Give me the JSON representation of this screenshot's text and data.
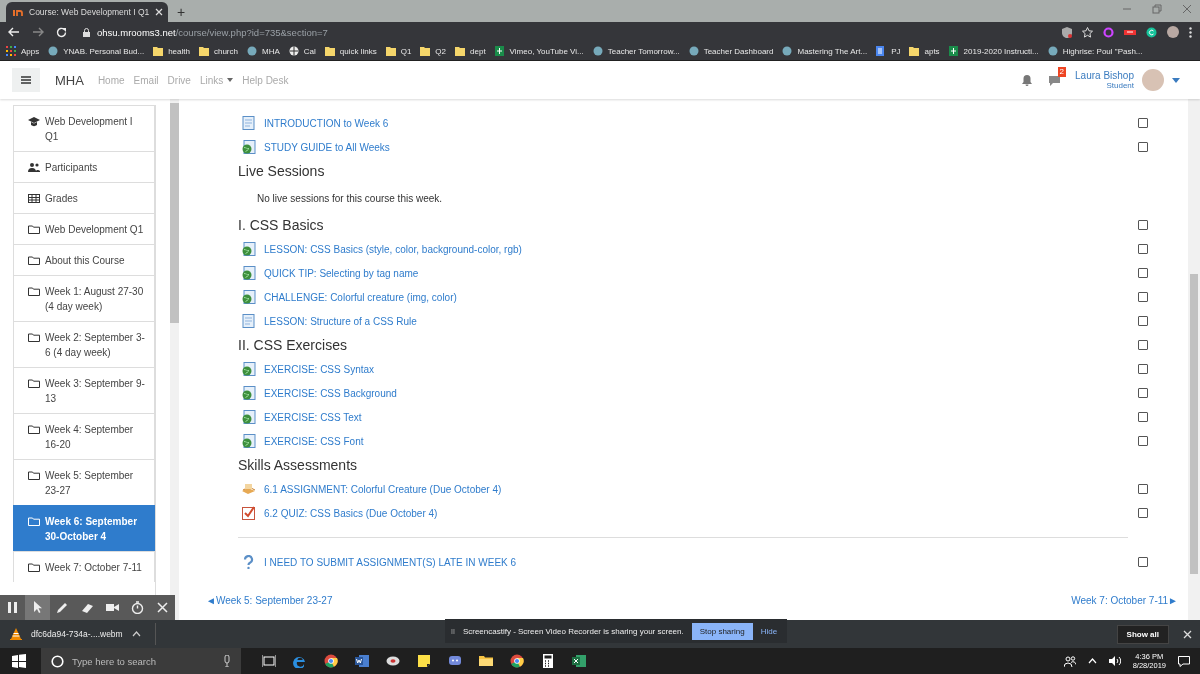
{
  "browser": {
    "tab_title": "Course: Web Development I Q1",
    "new_tab": "+",
    "url_host": "ohsu.mrooms3.net",
    "url_path": "/course/view.php?id=735&section=7",
    "bookmarks": [
      {
        "kind": "apps",
        "label": "Apps"
      },
      {
        "kind": "site",
        "label": "YNAB. Personal Bud..."
      },
      {
        "kind": "folder",
        "label": "health"
      },
      {
        "kind": "folder",
        "label": "church"
      },
      {
        "kind": "site",
        "label": "MHA"
      },
      {
        "kind": "globe",
        "label": "Cal"
      },
      {
        "kind": "folder",
        "label": "quick links"
      },
      {
        "kind": "folder",
        "label": "Q1"
      },
      {
        "kind": "folder",
        "label": "Q2"
      },
      {
        "kind": "folder",
        "label": "dept"
      },
      {
        "kind": "sheet",
        "label": "Vimeo, YouTube Vi..."
      },
      {
        "kind": "site",
        "label": "Teacher Tomorrow..."
      },
      {
        "kind": "site",
        "label": "Teacher Dashboard"
      },
      {
        "kind": "site",
        "label": "Mastering The Art..."
      },
      {
        "kind": "doc",
        "label": "PJ"
      },
      {
        "kind": "folder",
        "label": "apts"
      },
      {
        "kind": "sheet",
        "label": "2019-2020 Instructi..."
      },
      {
        "kind": "site",
        "label": "Highrise: Poul \"Pash..."
      }
    ]
  },
  "navbar": {
    "brand": "MHA",
    "links": [
      {
        "label": "Home",
        "dropdown": false
      },
      {
        "label": "Email",
        "dropdown": false
      },
      {
        "label": "Drive",
        "dropdown": false
      },
      {
        "label": "Links",
        "dropdown": true
      },
      {
        "label": "Help Desk",
        "dropdown": false
      }
    ],
    "message_count": "2",
    "user_name": "Laura Bishop",
    "user_role": "Student"
  },
  "sidebar": {
    "items": [
      {
        "kind": "course",
        "label": "Web Development I Q1",
        "selected": false
      },
      {
        "kind": "participants",
        "label": "Participants",
        "selected": false
      },
      {
        "kind": "grades",
        "label": "Grades",
        "selected": false
      },
      {
        "kind": "section",
        "label": "Web Development Q1",
        "selected": false
      },
      {
        "kind": "section",
        "label": "About this Course",
        "selected": false
      },
      {
        "kind": "section",
        "label": "Week 1: August 27-30 (4 day week)",
        "selected": false
      },
      {
        "kind": "section",
        "label": "Week 2: September 3-6 (4 day week)",
        "selected": false
      },
      {
        "kind": "section",
        "label": "Week 3: September 9-13",
        "selected": false
      },
      {
        "kind": "section",
        "label": "Week 4: September 16-20",
        "selected": false
      },
      {
        "kind": "section",
        "label": "Week 5: September 23-27",
        "selected": false
      },
      {
        "kind": "section",
        "label": "Week 6: September 30-October 4",
        "selected": true
      },
      {
        "kind": "section",
        "label": "Week 7: October 7-11",
        "selected": false
      }
    ]
  },
  "content": {
    "rows": [
      {
        "kind": "page",
        "label": "INTRODUCTION to Week 6",
        "checked": false
      },
      {
        "kind": "url",
        "label": "STUDY GUIDE to All Weeks",
        "checked": false
      },
      {
        "kind": "heading",
        "label": "Live Sessions"
      },
      {
        "kind": "note",
        "label": "No live sessions for this course this week."
      },
      {
        "kind": "heading",
        "label": "I. CSS Basics",
        "checked": false
      },
      {
        "kind": "url",
        "label": "LESSON: CSS Basics (style, color, background-color, rgb)",
        "checked": false
      },
      {
        "kind": "url",
        "label": "QUICK TIP: Selecting by tag name",
        "checked": false
      },
      {
        "kind": "url",
        "label": "CHALLENGE: Colorful creature (img, color)",
        "checked": false
      },
      {
        "kind": "page",
        "label": "LESSON: Structure of a CSS Rule",
        "checked": false
      },
      {
        "kind": "heading",
        "label": "II. CSS Exercises",
        "checked": false
      },
      {
        "kind": "url",
        "label": "EXERCISE: CSS Syntax",
        "checked": false
      },
      {
        "kind": "url",
        "label": "EXERCISE: CSS Background",
        "checked": false
      },
      {
        "kind": "url",
        "label": "EXERCISE: CSS Text",
        "checked": false
      },
      {
        "kind": "url",
        "label": "EXERCISE: CSS Font",
        "checked": false
      },
      {
        "kind": "heading",
        "label": "Skills Assessments"
      },
      {
        "kind": "assignment",
        "label": "6.1 ASSIGNMENT: Colorful Creature (Due October 4)",
        "checked": false
      },
      {
        "kind": "quiz",
        "label": "6.2 QUIZ: CSS Basics (Due October 4)",
        "checked": false
      },
      {
        "kind": "divider"
      },
      {
        "kind": "help",
        "label": "I NEED TO SUBMIT ASSIGNMENT(S) LATE IN WEEK 6",
        "checked": false
      }
    ],
    "prev_link": "◄Week 5: September 23-27",
    "next_link": "Week 7: October 7-11►"
  },
  "recorder_toolbar": {
    "tools": [
      {
        "kind": "pause",
        "selected": false
      },
      {
        "kind": "pointer",
        "selected": true
      },
      {
        "kind": "pen",
        "selected": false
      },
      {
        "kind": "eraser",
        "selected": false
      },
      {
        "kind": "camera",
        "selected": false
      },
      {
        "kind": "timer",
        "selected": false
      },
      {
        "kind": "close",
        "selected": false
      }
    ]
  },
  "download_bar": {
    "file": "dfc6da94-734a-....webm",
    "show_all": "Show all"
  },
  "sharing_notice": {
    "pause": "II",
    "text": "Screencastify - Screen Video Recorder is sharing your screen.",
    "stop": "Stop sharing",
    "hide": "Hide"
  },
  "taskbar": {
    "search_placeholder": "Type here to search",
    "apps": [
      {
        "kind": "taskview"
      },
      {
        "kind": "edge"
      },
      {
        "kind": "chrome"
      },
      {
        "kind": "word"
      },
      {
        "kind": "app"
      },
      {
        "kind": "notes"
      },
      {
        "kind": "discord"
      },
      {
        "kind": "files"
      },
      {
        "kind": "chrome"
      },
      {
        "kind": "calculator"
      },
      {
        "kind": "excel"
      }
    ],
    "time": "4:36 PM",
    "date": "8/28/2019"
  }
}
